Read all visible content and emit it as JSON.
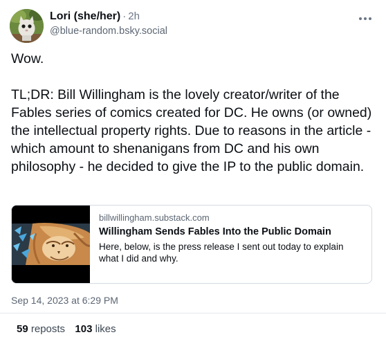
{
  "author": {
    "display_name": "Lori (she/her)",
    "separator": "·",
    "relative_time": "2h",
    "handle": "@blue-random.bsky.social"
  },
  "post": {
    "paragraphs": [
      "Wow.",
      "TL;DR: Bill Willingham is the lovely creator/writer of the Fables series of comics created for DC. He owns (or owned) the intellectual property rights. Due to reasons in the article -  which amount to shenanigans from DC and his own philosophy - he decided to give the IP to the public domain."
    ],
    "timestamp": "Sep 14, 2023 at 6:29 PM"
  },
  "link_card": {
    "domain": "billwillingham.substack.com",
    "title": "Willingham Sends Fables Into the Public Domain",
    "description": "Here, below, is the press release I sent out today to explain what I did and why."
  },
  "stats": {
    "reposts_count": "59",
    "reposts_label": "reposts",
    "likes_count": "103",
    "likes_label": "likes"
  },
  "icons": {
    "more": "more-options-icon"
  }
}
